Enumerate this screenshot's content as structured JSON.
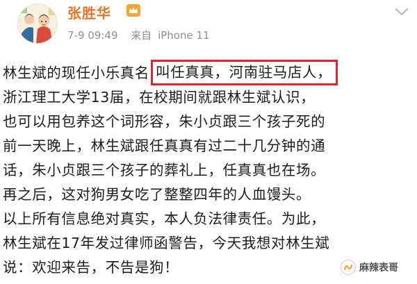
{
  "post": {
    "user": {
      "name": "张胜华",
      "badge_icon": "crown-icon",
      "name_color": "#e8742a"
    },
    "meta": {
      "time": "7-9 09:49",
      "source_prefix": "来自",
      "device": "iPhone 11"
    },
    "lines": [
      {
        "text": "林生斌的现任小乐真名",
        "highlight": "叫任真真，河南驻马店人，"
      },
      {
        "text": "浙江理工大学13届，在校期间就跟林生斌认识，"
      },
      {
        "text": "也可以用包养这个词形容，朱小贞跟三个孩子死的"
      },
      {
        "text": "前一天晚上，林生斌跟任真真有过二十几分钟的通"
      },
      {
        "text": "话，朱小贞跟三个孩子的葬礼上，任真真也在场。"
      },
      {
        "text": "再之后，这对狗男女吃了整整四年的人血馒头。"
      },
      {
        "text": "以上所有信息绝对真实，本人负法律责任。为此，"
      },
      {
        "text": "林生斌在17年发过律师函警告，今天我想对林生斌"
      },
      {
        "text": "说：欢迎来告，不告是狗！"
      }
    ],
    "highlight_color": "#ee1c25"
  },
  "watermark": {
    "text": "麻辣表哥",
    "icon": "wechat-channel-icon"
  }
}
